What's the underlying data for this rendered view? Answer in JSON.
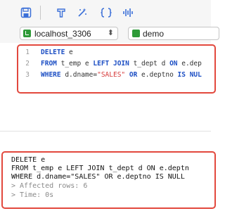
{
  "toolbar": {
    "icons": [
      "save-icon",
      "format-icon",
      "magic-wand-icon",
      "braces-icon",
      "waveform-icon"
    ]
  },
  "connection": {
    "label": "localhost_3306",
    "icon": "server-icon"
  },
  "database": {
    "label": "demo",
    "icon": "database-icon"
  },
  "editor": {
    "line_numbers": [
      "1",
      "2",
      "3"
    ],
    "lines": [
      [
        {
          "t": "DELETE",
          "c": "kw"
        },
        {
          "t": " e",
          "c": "id"
        }
      ],
      [
        {
          "t": "FROM",
          "c": "kw"
        },
        {
          "t": " t_emp e ",
          "c": "id"
        },
        {
          "t": "LEFT JOIN",
          "c": "kw"
        },
        {
          "t": " t_dept d ",
          "c": "id"
        },
        {
          "t": "ON",
          "c": "kw"
        },
        {
          "t": " e.dep",
          "c": "id"
        }
      ],
      [
        {
          "t": "WHERE",
          "c": "kw"
        },
        {
          "t": " d.dname=",
          "c": "id"
        },
        {
          "t": "\"SALES\"",
          "c": "str"
        },
        {
          "t": " ",
          "c": "id"
        },
        {
          "t": "OR",
          "c": "kw"
        },
        {
          "t": " e.deptno ",
          "c": "id"
        },
        {
          "t": "IS NUL",
          "c": "kw"
        }
      ]
    ]
  },
  "result": {
    "lines": [
      {
        "text": "DELETE e",
        "muted": false
      },
      {
        "text": "FROM t_emp e LEFT JOIN t_dept d ON e.deptn",
        "muted": false
      },
      {
        "text": "WHERE d.dname=\"SALES\" OR e.deptno IS NULL",
        "muted": false
      },
      {
        "text": "> Affected rows: 6",
        "muted": true
      },
      {
        "text": "> Time: 0s",
        "muted": true
      }
    ]
  },
  "colors": {
    "accent": "#1d4fc4",
    "highlight_border": "#e2483d",
    "keyword": "#1d4fc4",
    "string": "#d63a3a"
  }
}
